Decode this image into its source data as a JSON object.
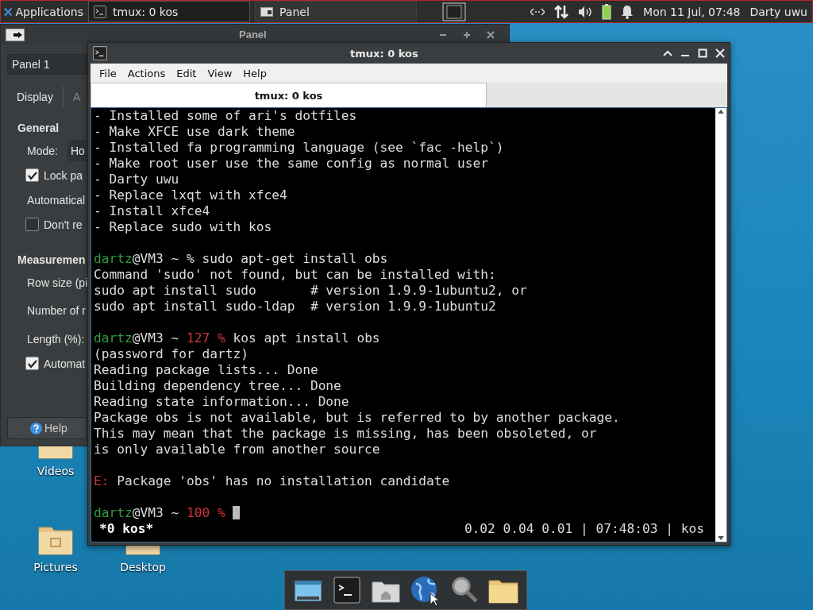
{
  "top_panel": {
    "menu_label": "Applications",
    "tasks": [
      {
        "label": "tmux: 0 kos",
        "selected": true
      },
      {
        "label": "Panel",
        "selected": false
      }
    ],
    "clock": "Mon 11 Jul, 07:48",
    "user": "Darty uwu"
  },
  "panel_window": {
    "title": "Panel",
    "panel_select": "Panel 1",
    "tabs": [
      {
        "label": "Display",
        "selected": true
      },
      {
        "label": "A",
        "selected": false
      }
    ],
    "items": [
      {
        "kind": "heading",
        "label": "General"
      },
      {
        "kind": "combo",
        "label": "Mode:",
        "value": "Ho"
      },
      {
        "kind": "check",
        "label": "Lock pa",
        "checked": true
      },
      {
        "kind": "label",
        "label": "Automatical"
      },
      {
        "kind": "check",
        "label": "Don't re",
        "checked": false
      },
      {
        "kind": "heading",
        "label": "Measuremen"
      },
      {
        "kind": "label",
        "label": "Row size (pi"
      },
      {
        "kind": "label",
        "label": "Number of r"
      },
      {
        "kind": "label",
        "label": "Length (%):"
      },
      {
        "kind": "check",
        "label": "Automat",
        "checked": true
      }
    ],
    "help_button": "Help"
  },
  "desktop_icons": [
    {
      "label": "Videos"
    },
    {
      "label": "Pictures"
    },
    {
      "label": "Desktop"
    }
  ],
  "terminal": {
    "title": "tmux: 0 kos",
    "menu": [
      "File",
      "Actions",
      "Edit",
      "View",
      "Help"
    ],
    "tab": "tmux: 0 kos",
    "lines": [
      {
        "spans": [
          {
            "kind": "plain",
            "text": "- Installed some of ari's dotfiles"
          }
        ]
      },
      {
        "spans": [
          {
            "kind": "plain",
            "text": "- Make XFCE use dark theme"
          }
        ]
      },
      {
        "spans": [
          {
            "kind": "plain",
            "text": "- Installed fa programming language (see `fac -help`)"
          }
        ]
      },
      {
        "spans": [
          {
            "kind": "plain",
            "text": "- Make root user use the same config as normal user"
          }
        ]
      },
      {
        "spans": [
          {
            "kind": "plain",
            "text": "- Darty uwu"
          }
        ]
      },
      {
        "spans": [
          {
            "kind": "plain",
            "text": "- Replace lxqt with xfce4"
          }
        ]
      },
      {
        "spans": [
          {
            "kind": "plain",
            "text": "- Install xfce4"
          }
        ]
      },
      {
        "spans": [
          {
            "kind": "plain",
            "text": "- Replace sudo with kos"
          }
        ]
      },
      {
        "gap_before": true,
        "spans": [
          {
            "kind": "user",
            "text": "dartz"
          },
          {
            "kind": "plain",
            "text": "@VM3 ~ % sudo apt-get install obs"
          }
        ]
      },
      {
        "spans": [
          {
            "kind": "plain",
            "text": "Command 'sudo' not found, but can be installed with:"
          }
        ]
      },
      {
        "spans": [
          {
            "kind": "plain",
            "text": "sudo apt install sudo       # version 1.9.9-1ubuntu2, or"
          }
        ]
      },
      {
        "spans": [
          {
            "kind": "plain",
            "text": "sudo apt install sudo-ldap  # version 1.9.9-1ubuntu2"
          }
        ]
      },
      {
        "gap_before": true,
        "spans": [
          {
            "kind": "user",
            "text": "dartz"
          },
          {
            "kind": "plain",
            "text": "@VM3 ~ "
          },
          {
            "kind": "error",
            "text": "127 %"
          },
          {
            "kind": "plain",
            "text": " kos apt install obs"
          }
        ]
      },
      {
        "spans": [
          {
            "kind": "plain",
            "text": "(password for dartz)"
          }
        ]
      },
      {
        "spans": [
          {
            "kind": "plain",
            "text": "Reading package lists... Done"
          }
        ]
      },
      {
        "spans": [
          {
            "kind": "plain",
            "text": "Building dependency tree... Done"
          }
        ]
      },
      {
        "spans": [
          {
            "kind": "plain",
            "text": "Reading state information... Done"
          }
        ]
      },
      {
        "spans": [
          {
            "kind": "plain",
            "text": "Package obs is not available, but is referred to by another package."
          }
        ]
      },
      {
        "spans": [
          {
            "kind": "plain",
            "text": "This may mean that the package is missing, has been obsoleted, or"
          }
        ]
      },
      {
        "spans": [
          {
            "kind": "plain",
            "text": "is only available from another source"
          }
        ]
      },
      {
        "gap_before": true,
        "spans": [
          {
            "kind": "error",
            "text": "E:"
          },
          {
            "kind": "plain",
            "text": " Package 'obs' has no installation candidate"
          }
        ]
      },
      {
        "gap_before": true,
        "cursor": true,
        "spans": [
          {
            "kind": "user",
            "text": "dartz"
          },
          {
            "kind": "plain",
            "text": "@VM3 ~ "
          },
          {
            "kind": "error",
            "text": "100 %"
          }
        ]
      }
    ],
    "status_left": "*0 kos*",
    "status_right": "0.02 0.04 0.01 | 07:48:03 | kos"
  }
}
